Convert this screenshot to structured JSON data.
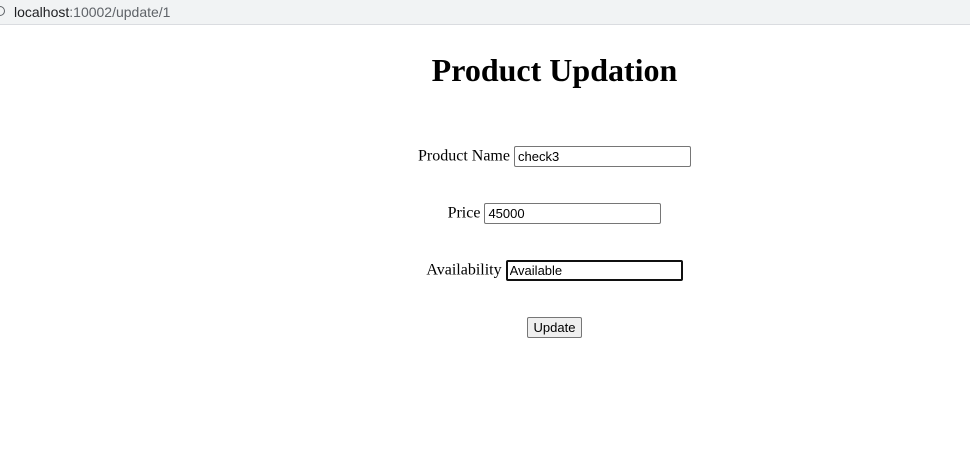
{
  "browser": {
    "url_host": "localhost",
    "url_path": ":10002/update/1"
  },
  "page": {
    "title": "Product Updation"
  },
  "form": {
    "product_name": {
      "label": "Product Name",
      "value": "check3"
    },
    "price": {
      "label": "Price",
      "value": "45000"
    },
    "availability": {
      "label": "Availability",
      "value": "Available"
    },
    "submit_label": "Update"
  },
  "icons": {
    "reload": "reload-icon"
  }
}
